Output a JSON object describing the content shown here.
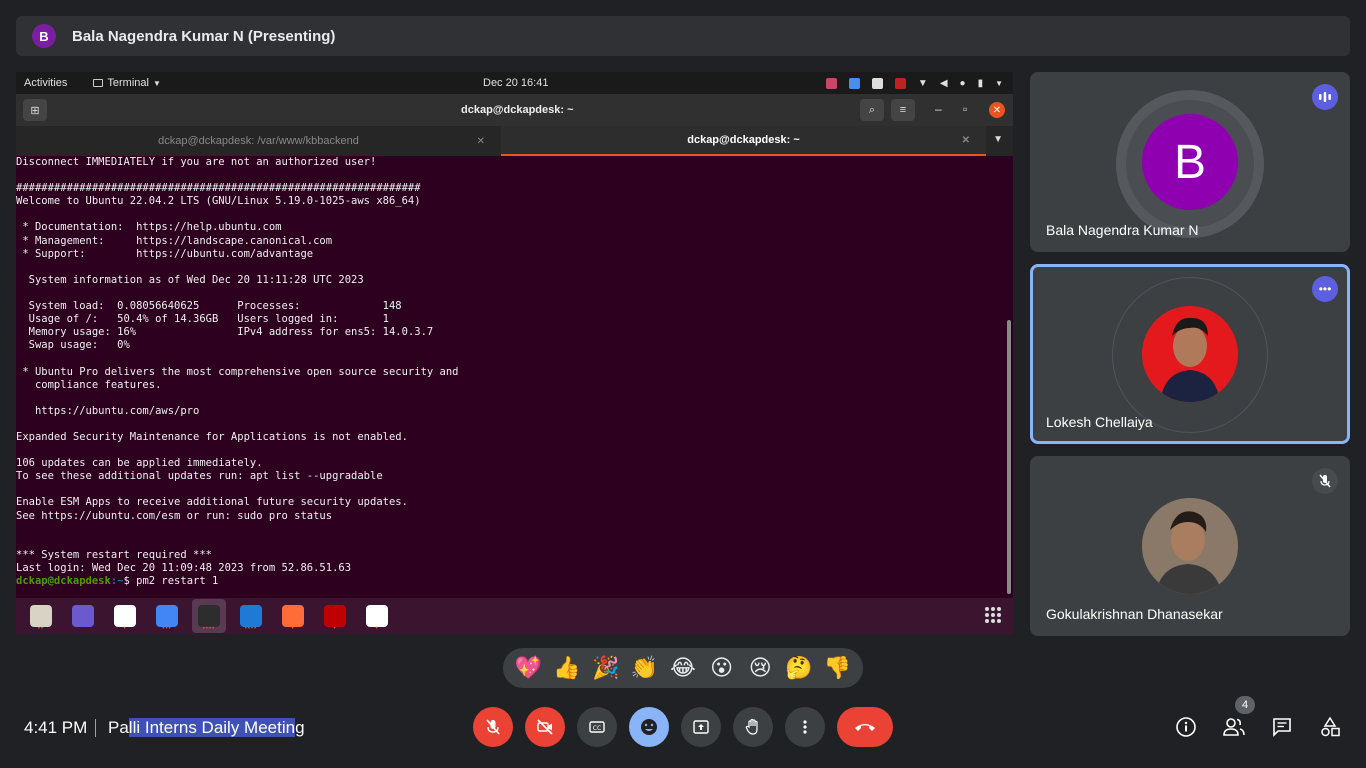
{
  "presenter": {
    "initial": "B",
    "label": "Bala Nagendra Kumar N (Presenting)"
  },
  "gnome": {
    "activities": "Activities",
    "app_menu": "Terminal",
    "clock": "Dec 20  16:41"
  },
  "terminal": {
    "window_title": "dckap@dckapdesk: ~",
    "tabs": [
      {
        "label": "dckap@dckapdesk: /var/www/kbbackend",
        "active": false
      },
      {
        "label": "dckap@dckapdesk: ~",
        "active": true
      }
    ],
    "lines": [
      "Disconnect IMMEDIATELY if you are not an authorized user!",
      "",
      "################################################################",
      "Welcome to Ubuntu 22.04.2 LTS (GNU/Linux 5.19.0-1025-aws x86_64)",
      "",
      " * Documentation:  https://help.ubuntu.com",
      " * Management:     https://landscape.canonical.com",
      " * Support:        https://ubuntu.com/advantage",
      "",
      "  System information as of Wed Dec 20 11:11:28 UTC 2023",
      "",
      "  System load:  0.08056640625      Processes:             148",
      "  Usage of /:   50.4% of 14.36GB   Users logged in:       1",
      "  Memory usage: 16%                IPv4 address for ens5: 14.0.3.7",
      "  Swap usage:   0%",
      "",
      " * Ubuntu Pro delivers the most comprehensive open source security and",
      "   compliance features.",
      "",
      "   https://ubuntu.com/aws/pro",
      "",
      "Expanded Security Maintenance for Applications is not enabled.",
      "",
      "106 updates can be applied immediately.",
      "To see these additional updates run: apt list --upgradable",
      "",
      "Enable ESM Apps to receive additional future security updates.",
      "See https://ubuntu.com/esm or run: sudo pro status",
      "",
      "",
      "*** System restart required ***",
      "Last login: Wed Dec 20 11:09:48 2023 from 52.86.51.63"
    ],
    "prompt_user": "dckap@dckapdesk",
    "prompt_path": ":~",
    "prompt_cmd": "$ pm2 restart 1"
  },
  "dock": {
    "apps": [
      {
        "name": "files-icon",
        "color": "#d8d3c4",
        "dots": "••",
        "active": false
      },
      {
        "name": "screenshot-icon",
        "color": "#6a5acd",
        "dots": "",
        "active": false
      },
      {
        "name": "slack-icon",
        "color": "#ffffff",
        "dots": "•",
        "active": false
      },
      {
        "name": "chrome-icon",
        "color": "#4285f4",
        "dots": "•••",
        "active": false
      },
      {
        "name": "terminal-icon",
        "color": "#2d2d2d",
        "dots": "••••",
        "active": true
      },
      {
        "name": "vscode-icon",
        "color": "#1f7ad6",
        "dots": "••••",
        "active": false
      },
      {
        "name": "postman-icon",
        "color": "#ff6c37",
        "dots": "•",
        "active": false
      },
      {
        "name": "filezilla-icon",
        "color": "#bf0000",
        "dots": "•",
        "active": false
      },
      {
        "name": "pgadmin-icon",
        "color": "#ffffff",
        "dots": "•",
        "active": false
      }
    ]
  },
  "participants": [
    {
      "name": "Bala Nagendra Kumar N",
      "initial": "B",
      "color": "#8f00b0"
    },
    {
      "name": "Lokesh Chellaiya"
    },
    {
      "name": "Gokulakrishnan Dhanasekar"
    }
  ],
  "reactions": [
    "💖",
    "👍",
    "🎉",
    "👏",
    "😂",
    "😮",
    "😢",
    "🤔",
    "👎"
  ],
  "meeting": {
    "time": "4:41 PM",
    "title_pre": "Pa",
    "title_hl": "lli Interns Daily Meetin",
    "title_post": "g"
  },
  "people_count": "4",
  "colors": {
    "accent": "#8ab4f8",
    "danger": "#ea4335",
    "terminal_bg": "#2c001e",
    "ubuntu_orange": "#e95420"
  }
}
